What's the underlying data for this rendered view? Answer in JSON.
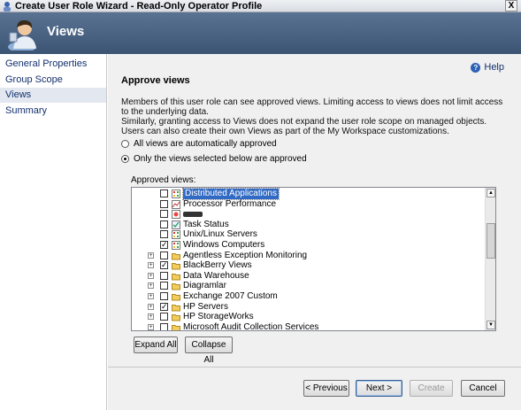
{
  "window": {
    "title": "Create User Role Wizard - Read-Only Operator Profile",
    "close_label": "X"
  },
  "banner": {
    "heading": "Views"
  },
  "sidebar": {
    "items": [
      {
        "label": "General Properties"
      },
      {
        "label": "Group Scope"
      },
      {
        "label": "Views"
      },
      {
        "label": "Summary"
      }
    ]
  },
  "content": {
    "help_label": "Help",
    "section_title": "Approve views",
    "description_1": "Members of this user role can see approved views. Limiting access to views does not limit access to the underlying data.",
    "description_2": "Similarly, granting access to Views does not expand the user role scope on managed objects. Users can also create their own Views as part of the My Workspace customizations.",
    "radio_all": "All views are automatically approved",
    "radio_selected": "Only the views selected below are approved",
    "approved_views_label": "Approved views:",
    "tree": [
      {
        "label": "Distributed Applications",
        "checked": false,
        "expander": false,
        "icon": "state-view-icon",
        "selected": true
      },
      {
        "label": "Processor Performance",
        "checked": false,
        "expander": false,
        "icon": "performance-view-icon"
      },
      {
        "label": "",
        "checked": false,
        "expander": false,
        "icon": "alert-view-icon",
        "redacted": true
      },
      {
        "label": "Task Status",
        "checked": false,
        "expander": false,
        "icon": "task-view-icon"
      },
      {
        "label": "Unix/Linux Servers",
        "checked": false,
        "expander": false,
        "icon": "state-view-icon"
      },
      {
        "label": "Windows Computers",
        "checked": true,
        "expander": false,
        "icon": "state-view-icon"
      },
      {
        "label": "Agentless Exception Monitoring",
        "checked": false,
        "expander": true,
        "icon": "folder-icon"
      },
      {
        "label": "BlackBerry Views",
        "checked": true,
        "expander": true,
        "icon": "folder-icon"
      },
      {
        "label": "Data Warehouse",
        "checked": false,
        "expander": true,
        "icon": "folder-icon"
      },
      {
        "label": "Diagramlar",
        "checked": false,
        "expander": true,
        "icon": "folder-icon"
      },
      {
        "label": "Exchange 2007 Custom",
        "checked": false,
        "expander": true,
        "icon": "folder-icon"
      },
      {
        "label": "HP Servers",
        "checked": true,
        "expander": true,
        "icon": "folder-icon"
      },
      {
        "label": "HP StorageWorks",
        "checked": false,
        "expander": true,
        "icon": "folder-icon"
      },
      {
        "label": "Microsoft Audit Collection Services",
        "checked": false,
        "expander": true,
        "icon": "folder-icon"
      }
    ],
    "expand_all": "Expand All",
    "collapse_all": "Collapse All"
  },
  "footer": {
    "previous": "< Previous",
    "next": "Next >",
    "create": "Create",
    "cancel": "Cancel"
  },
  "colors": {
    "banner": "#4a6283",
    "selection": "#316ac5",
    "link": "#13306e"
  }
}
